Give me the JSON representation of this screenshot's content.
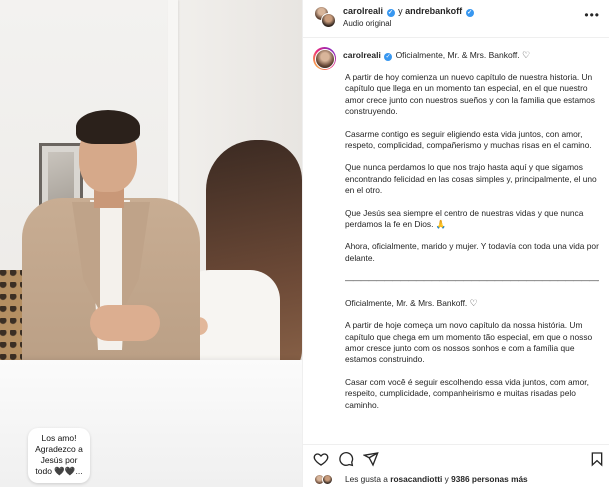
{
  "media": {
    "sticker_text": "Los amo! Agradezco a Jesús por todo 🖤🖤..."
  },
  "header": {
    "user1": "carolreali",
    "conjunction": "y",
    "user2": "andrebankoff",
    "audio": "Audio original",
    "more_icon": "more-horizontal-icon"
  },
  "caption": {
    "author": "carolreali",
    "headline": "Oficialmente, Mr. & Mrs. Bankoff.",
    "paragraphs": [
      "A partir de hoy comienza un nuevo capítulo de nuestra historia. Un capítulo que llega en un momento tan especial, en el que nuestro amor crece junto con nuestros sueños y con la familia que estamos construyendo.",
      "Casarme contigo es seguir eligiendo esta vida juntos, con amor, respeto, complicidad, compañerismo y muchas risas en el camino.",
      "Que nunca perdamos lo que nos trajo hasta aquí y que sigamos encontrando felicidad en las cosas simples y, principalmente, el uno en el otro.",
      "Que Jesús sea siempre el centro de nuestras vidas y que nunca perdamos la fe en Dios. 🙏",
      "Ahora, oficialmente, marido y mujer. Y todavía con toda una vida por delante."
    ],
    "rule": "—————————————————————————————————",
    "headline_pt": "Oficialmente, Mr. & Mrs. Bankoff.",
    "paragraphs_pt": [
      "A partir de hoje começa um novo capítulo da nossa história. Um capítulo que chega em um momento tão especial, em que o nosso amor cresce junto com os nossos sonhos e com a família que estamos construindo.",
      "Casar com você é seguir escolhendo essa vida juntos, com amor, respeito, cumplicidade, companheirismo e muitas risadas pelo caminho."
    ]
  },
  "actions": {
    "icons": [
      "heart-icon",
      "comment-icon",
      "share-icon",
      "bookmark-icon"
    ]
  },
  "likes": {
    "prefix": "Les gusta a",
    "user": "rosacandiotti",
    "middle": "y",
    "count": "9386 personas más"
  }
}
